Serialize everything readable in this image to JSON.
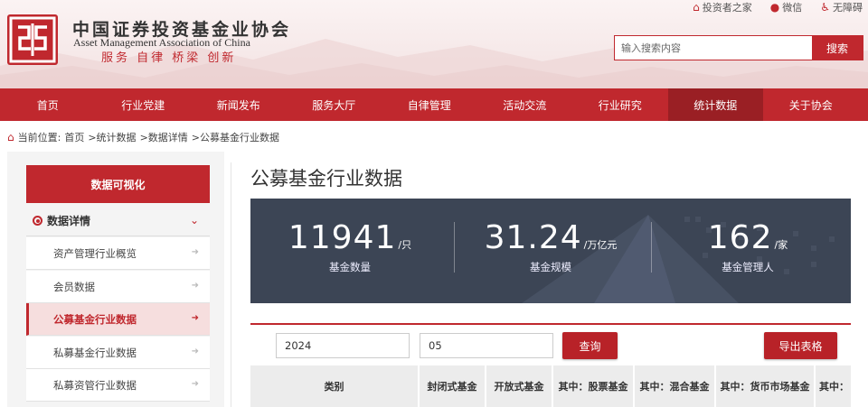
{
  "colors": {
    "brand_red": "#c0282e",
    "nav_active": "#9a1f24",
    "stats_bg": "#3c4555"
  },
  "header": {
    "org_name_cn": "中国证券投资基金业协会",
    "org_name_en": "Asset Management Association of China",
    "slogan": "服务  自律  桥梁  创新",
    "top_links": [
      {
        "icon": "investor-home-icon",
        "label": "投资者之家"
      },
      {
        "icon": "wechat-icon",
        "label": "微信"
      },
      {
        "icon": "accessibility-icon",
        "label": "无障碍"
      }
    ],
    "search": {
      "placeholder": "输入搜索内容",
      "button_label": "搜索"
    }
  },
  "nav": {
    "items": [
      "首页",
      "行业党建",
      "新闻发布",
      "服务大厅",
      "自律管理",
      "活动交流",
      "行业研究",
      "统计数据",
      "关于协会"
    ],
    "active": "统计数据"
  },
  "breadcrumb": {
    "prefix": "当前位置:",
    "items": [
      "首页",
      ">统计数据",
      ">数据详情",
      ">公募基金行业数据"
    ]
  },
  "sidebar": {
    "header": "数据可视化",
    "category": "数据详情",
    "items": [
      "资产管理行业概览",
      "会员数据",
      "公募基金行业数据",
      "私募基金行业数据",
      "私募资管行业数据"
    ],
    "active": "公募基金行业数据"
  },
  "main": {
    "title": "公募基金行业数据",
    "stats": [
      {
        "value": "11941",
        "unit": "/只",
        "label": "基金数量"
      },
      {
        "value": "31.24",
        "unit": "/万亿元",
        "label": "基金规模"
      },
      {
        "value": "162",
        "unit": "/家",
        "label": "基金管理人"
      }
    ],
    "filter": {
      "year": "2024",
      "month": "05",
      "query_label": "查询",
      "export_label": "导出表格"
    },
    "table_headers": [
      "类别",
      "封闭式基金",
      "开放式基金",
      "其中：股票基金",
      "其中：混合基金",
      "其中：货币市场基金",
      "其中："
    ]
  }
}
